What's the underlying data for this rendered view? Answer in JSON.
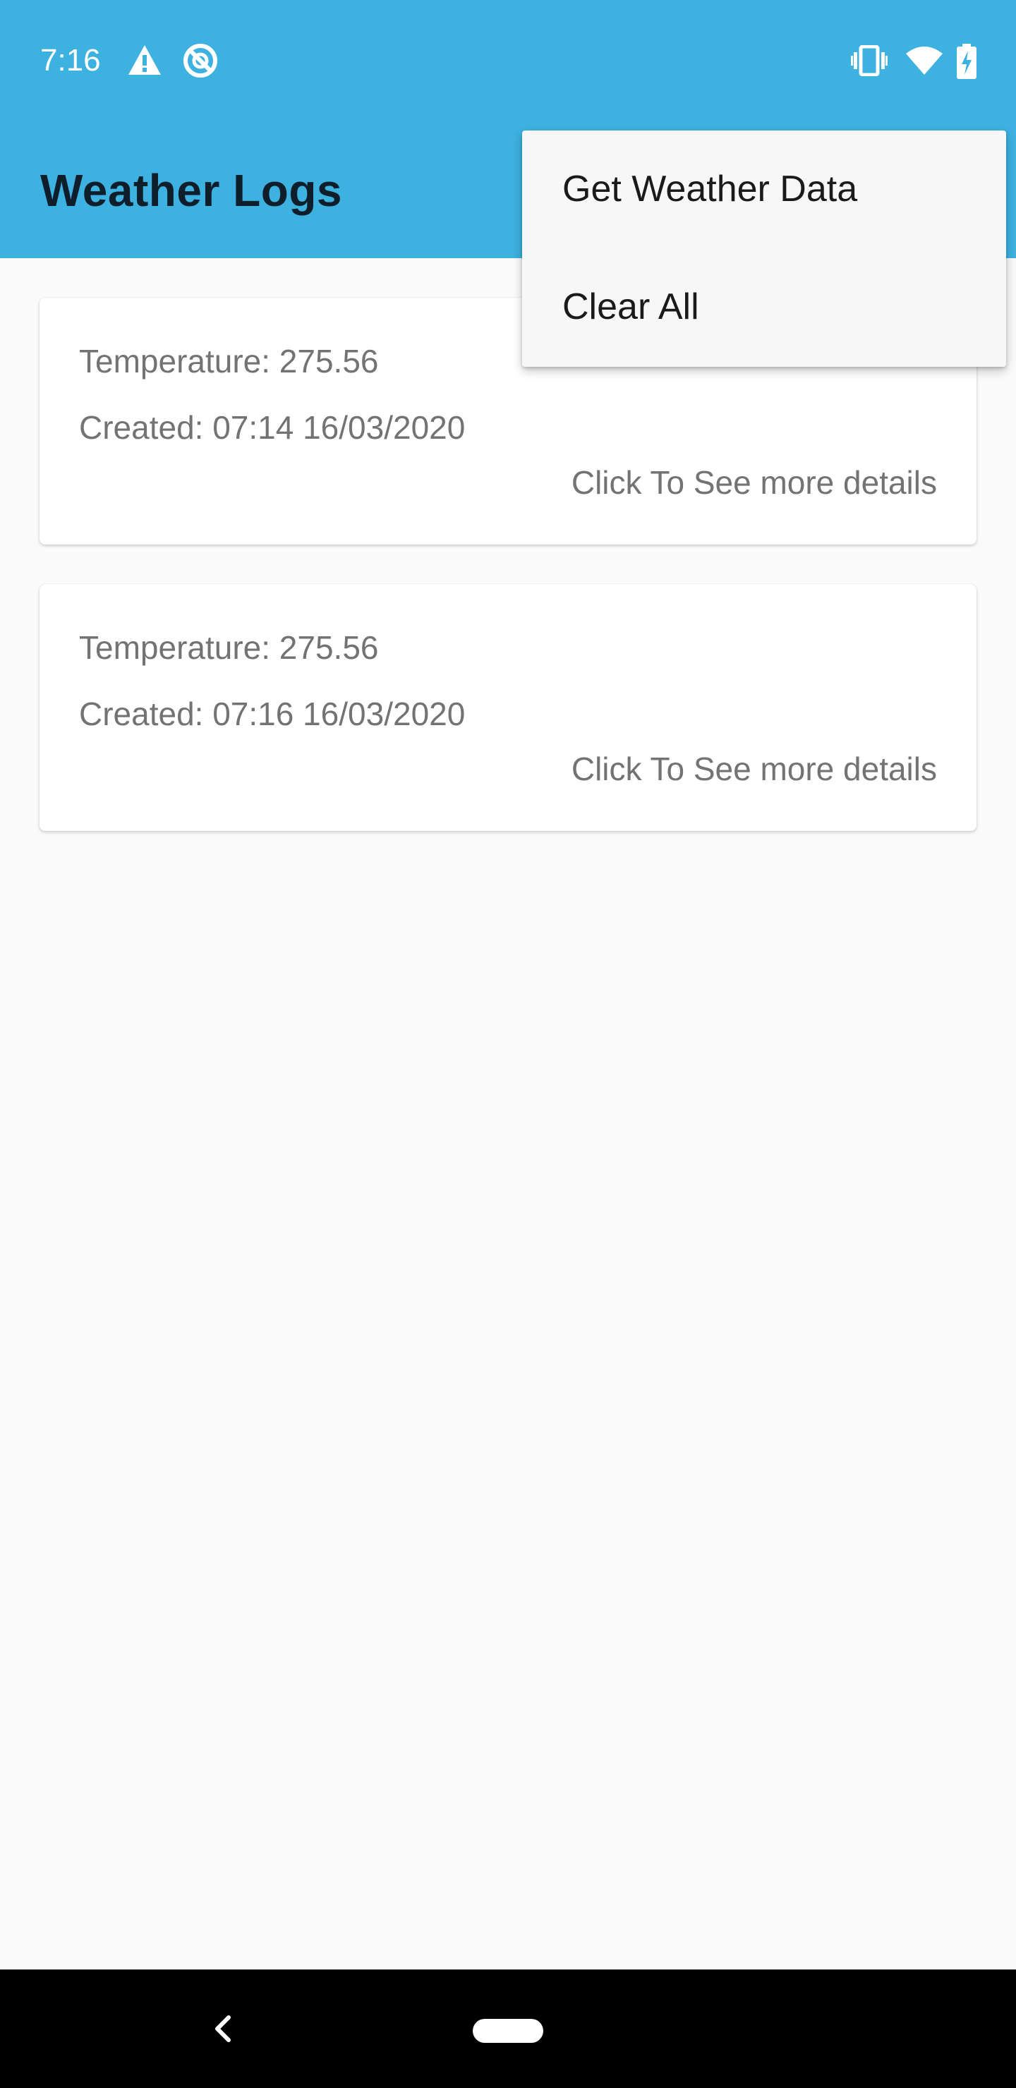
{
  "status_bar": {
    "time": "7:16",
    "icons": [
      "warning-icon",
      "do-not-disturb-icon",
      "vibrate-icon",
      "wifi-icon",
      "battery-charging-icon"
    ],
    "background": "#3db1e0"
  },
  "app_bar": {
    "title": "Weather Logs",
    "background": "#3db1e0"
  },
  "logs": [
    {
      "temperature": "Temperature: 275.56",
      "created": "Created: 07:14 16/03/2020",
      "details_link": "Click To See more details"
    },
    {
      "temperature": "Temperature: 275.56",
      "created": "Created: 07:16 16/03/2020",
      "details_link": "Click To See more details"
    }
  ],
  "overflow_menu": {
    "items": [
      {
        "label": "Get Weather Data"
      },
      {
        "label": "Clear All"
      }
    ]
  },
  "nav_bar": {
    "icons": [
      "back-icon",
      "home-pill-icon"
    ]
  }
}
